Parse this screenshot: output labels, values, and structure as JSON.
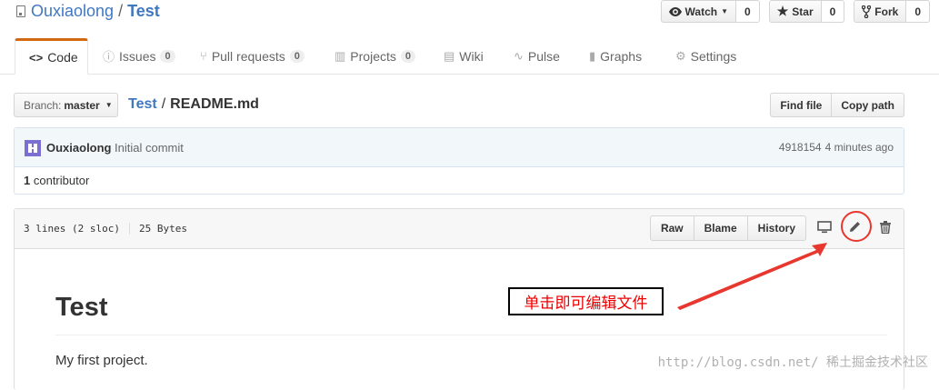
{
  "repo": {
    "owner": "Ouxiaolong",
    "separator": "/",
    "name": "Test"
  },
  "actions": {
    "watch_label": "Watch",
    "watch_count": "0",
    "star_label": "Star",
    "star_count": "0",
    "fork_label": "Fork",
    "fork_count": "0"
  },
  "tabs": [
    {
      "label": "Code"
    },
    {
      "label": "Issues",
      "counter": "0"
    },
    {
      "label": "Pull requests",
      "counter": "0"
    },
    {
      "label": "Projects",
      "counter": "0"
    },
    {
      "label": "Wiki"
    },
    {
      "label": "Pulse"
    },
    {
      "label": "Graphs"
    },
    {
      "label": "Settings"
    }
  ],
  "branch": {
    "prefix": "Branch:",
    "name": "master"
  },
  "breadcrumb": {
    "repo": "Test",
    "separator": "/",
    "file": "README.md"
  },
  "file_nav": {
    "find_file": "Find file",
    "copy_path": "Copy path"
  },
  "commit": {
    "author": "Ouxiaolong",
    "message": "Initial commit",
    "sha": "4918154",
    "time": "4 minutes ago",
    "contributors_count": "1",
    "contributors_label": "contributor"
  },
  "file": {
    "lines": "3 lines (2 sloc)",
    "size": "25 Bytes",
    "raw": "Raw",
    "blame": "Blame",
    "history": "History"
  },
  "readme": {
    "title": "Test",
    "body": "My first project."
  },
  "annotation": {
    "text": "单击即可编辑文件",
    "color": "#e8372e"
  },
  "watermark": "http://blog.csdn.net/ 稀土掘金技术社区",
  "colors": {
    "link": "#4078c0",
    "tab_accent": "#d26911",
    "commit_bg": "#f2f8fa"
  }
}
